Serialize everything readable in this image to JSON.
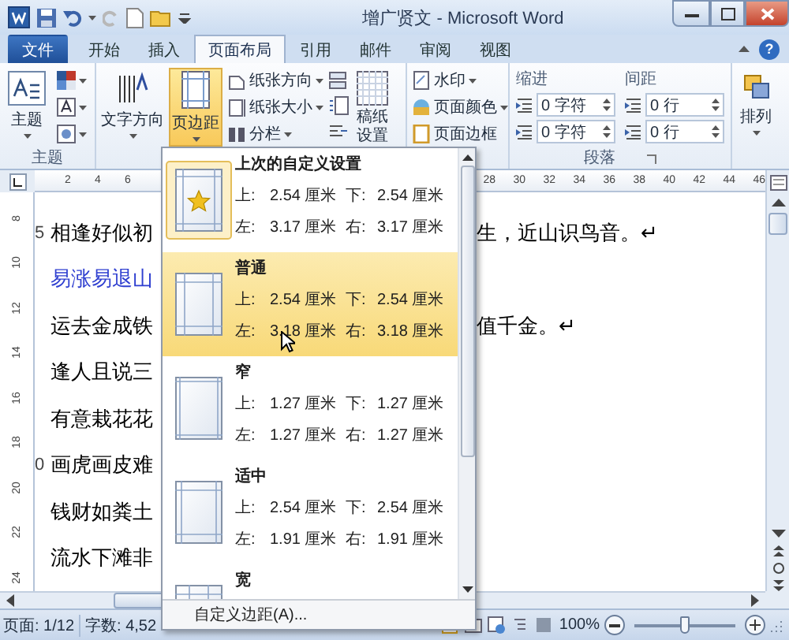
{
  "window": {
    "title": "增广贤文 - Microsoft Word"
  },
  "tabs": [
    {
      "label": "文件",
      "kind": "file",
      "selected": false
    },
    {
      "label": "开始",
      "kind": "tab",
      "selected": false
    },
    {
      "label": "插入",
      "kind": "tab",
      "selected": false
    },
    {
      "label": "页面布局",
      "kind": "tab",
      "selected": true
    },
    {
      "label": "引用",
      "kind": "tab",
      "selected": false
    },
    {
      "label": "邮件",
      "kind": "tab",
      "selected": false
    },
    {
      "label": "审阅",
      "kind": "tab",
      "selected": false
    },
    {
      "label": "视图",
      "kind": "tab",
      "selected": false
    }
  ],
  "help": "?",
  "ribbon": {
    "themes": {
      "button": "主题",
      "group_label": "主题"
    },
    "text_direction": "文字方向",
    "margins": {
      "label": "页边距",
      "open": true
    },
    "page_setup": [
      {
        "label": "纸张方向",
        "dropdown": true
      },
      {
        "label": "纸张大小",
        "dropdown": true
      },
      {
        "label": "分栏",
        "dropdown": true
      }
    ],
    "draft_paper": "稿纸设置",
    "page_background": [
      {
        "label": "水印",
        "dropdown": true
      },
      {
        "label": "页面颜色",
        "dropdown": true
      },
      {
        "label": "页面边框",
        "dropdown": false
      }
    ],
    "paragraph": {
      "group_label": "段落",
      "indent": {
        "label": "缩进",
        "fields": [
          "0 字符",
          "0 字符"
        ]
      },
      "spacing": {
        "label": "间距",
        "fields": [
          "0 行",
          "0 行"
        ]
      }
    },
    "arrange": "排列"
  },
  "ruler": {
    "left_ticks": [
      "2",
      "4",
      "6"
    ],
    "right_ticks": [
      "28",
      "30",
      "32",
      "34",
      "36",
      "38",
      "40",
      "42",
      "44",
      "46"
    ]
  },
  "vertical_ruler": [
    "8",
    "10",
    "12",
    "14",
    "16",
    "18",
    "20",
    "22",
    "24"
  ],
  "document": {
    "lines": [
      {
        "number": "5",
        "left": "相逢好似初",
        "right": "生，近山识鸟音。↵",
        "color": "#000000"
      },
      {
        "left": "易涨易退山",
        "color": "#2f3fd0"
      },
      {
        "left": "运去金成铁",
        "right": "值千金。↵",
        "color": "#000000"
      },
      {
        "left": "逢人且说三",
        "color": "#000000"
      },
      {
        "left": "有意栽花花",
        "color": "#000000"
      },
      {
        "number": "0",
        "left": "画虎画皮难",
        "color": "#000000"
      },
      {
        "left": "钱财如粪土",
        "color": "#000000"
      },
      {
        "left": "流水下滩非",
        "color": "#000000"
      }
    ]
  },
  "margins_menu": {
    "items": [
      {
        "title": "上次的自定义设置",
        "kind": "star",
        "current": true,
        "hovered": false,
        "values": [
          {
            "label": "上:",
            "value": "2.54 厘米"
          },
          {
            "label": "下:",
            "value": "2.54 厘米"
          },
          {
            "label": "左:",
            "value": "3.17 厘米"
          },
          {
            "label": "右:",
            "value": "3.17 厘米"
          }
        ]
      },
      {
        "title": "普通",
        "kind": "normal",
        "current": false,
        "hovered": true,
        "values": [
          {
            "label": "上:",
            "value": "2.54 厘米"
          },
          {
            "label": "下:",
            "value": "2.54 厘米"
          },
          {
            "label": "左:",
            "value": "3.18 厘米"
          },
          {
            "label": "右:",
            "value": "3.18 厘米"
          }
        ]
      },
      {
        "title": "窄",
        "kind": "narrow",
        "current": false,
        "hovered": false,
        "values": [
          {
            "label": "上:",
            "value": "1.27 厘米"
          },
          {
            "label": "下:",
            "value": "1.27 厘米"
          },
          {
            "label": "左:",
            "value": "1.27 厘米"
          },
          {
            "label": "右:",
            "value": "1.27 厘米"
          }
        ]
      },
      {
        "title": "适中",
        "kind": "moderate",
        "current": false,
        "hovered": false,
        "values": [
          {
            "label": "上:",
            "value": "2.54 厘米"
          },
          {
            "label": "下:",
            "value": "2.54 厘米"
          },
          {
            "label": "左:",
            "value": "1.91 厘米"
          },
          {
            "label": "右:",
            "value": "1.91 厘米"
          }
        ]
      },
      {
        "title": "宽",
        "kind": "wide",
        "current": false,
        "hovered": false
      }
    ],
    "footer": "自定义边距(A)..."
  },
  "status_bar": {
    "page": "页面: 1/12",
    "words": "字数: 4,52",
    "zoom": "100%",
    "zoom_slider": {
      "level": 0.5
    }
  }
}
